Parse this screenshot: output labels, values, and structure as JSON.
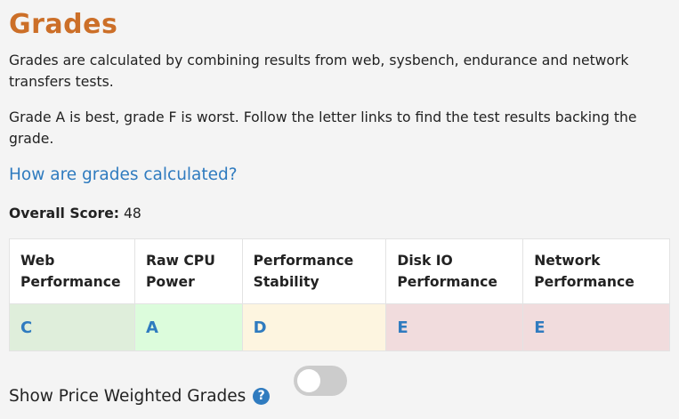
{
  "heading": "Grades",
  "intro": "Grades are calculated by combining results from web, sysbench, endurance and network transfers tests.",
  "explanation": "Grade A is best, grade F is worst. Follow the letter links to find the test results backing the grade.",
  "how_link": "How are grades calculated?",
  "overall": {
    "label": "Overall Score:",
    "value": "48"
  },
  "columns": [
    {
      "header": "Web Performance",
      "grade": "C",
      "bg": "#dfeedb"
    },
    {
      "header": "Raw CPU Power",
      "grade": "A",
      "bg": "#dcfcdc"
    },
    {
      "header": "Performance Stability",
      "grade": "D",
      "bg": "#fdf5e0"
    },
    {
      "header": "Disk IO Performance",
      "grade": "E",
      "bg": "#f1dcdd"
    },
    {
      "header": "Network Performance",
      "grade": "E",
      "bg": "#f1dcdd"
    }
  ],
  "price_toggle": {
    "label": "Show Price Weighted Grades",
    "help_icon": "question-circle-icon",
    "on": false
  },
  "colors": {
    "heading": "#cc6f28",
    "link": "#2f7bbf"
  }
}
